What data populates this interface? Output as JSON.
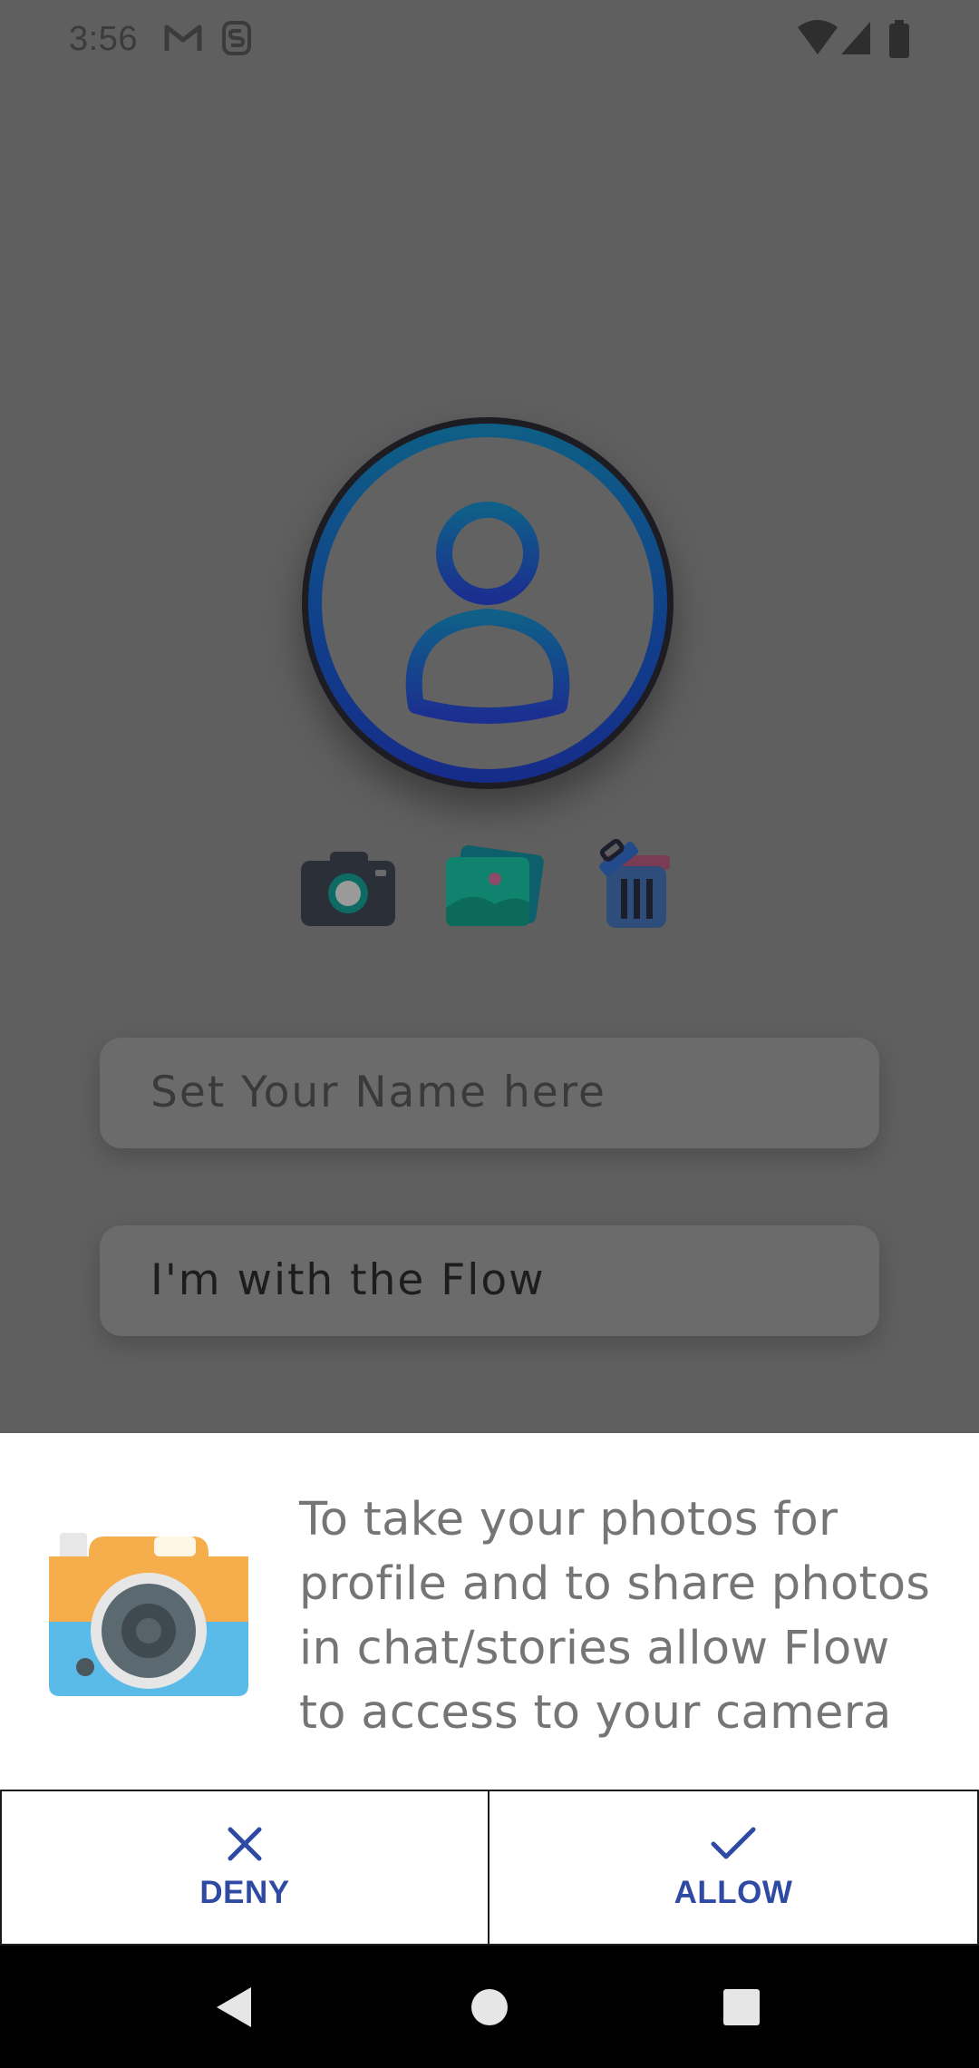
{
  "status_bar": {
    "time": "3:56",
    "icons": [
      "gmail-icon",
      "s-app-icon",
      "wifi-icon",
      "signal-icon",
      "battery-icon"
    ]
  },
  "profile": {
    "avatar_icon": "person-icon",
    "actions": [
      "camera-icon",
      "gallery-icon",
      "delete-icon"
    ]
  },
  "form": {
    "name_placeholder": "Set Your Name here",
    "status_value": "I'm with the Flow"
  },
  "permission_sheet": {
    "icon": "camera-icon",
    "message": "To take your photos for profile and to share photos in chat/stories allow Flow to access to your camera",
    "deny_label": "DENY",
    "allow_label": "ALLOW",
    "accent_color": "#2f4aa3"
  },
  "nav_bar": {
    "buttons": [
      "back-icon",
      "home-icon",
      "recents-icon"
    ]
  }
}
